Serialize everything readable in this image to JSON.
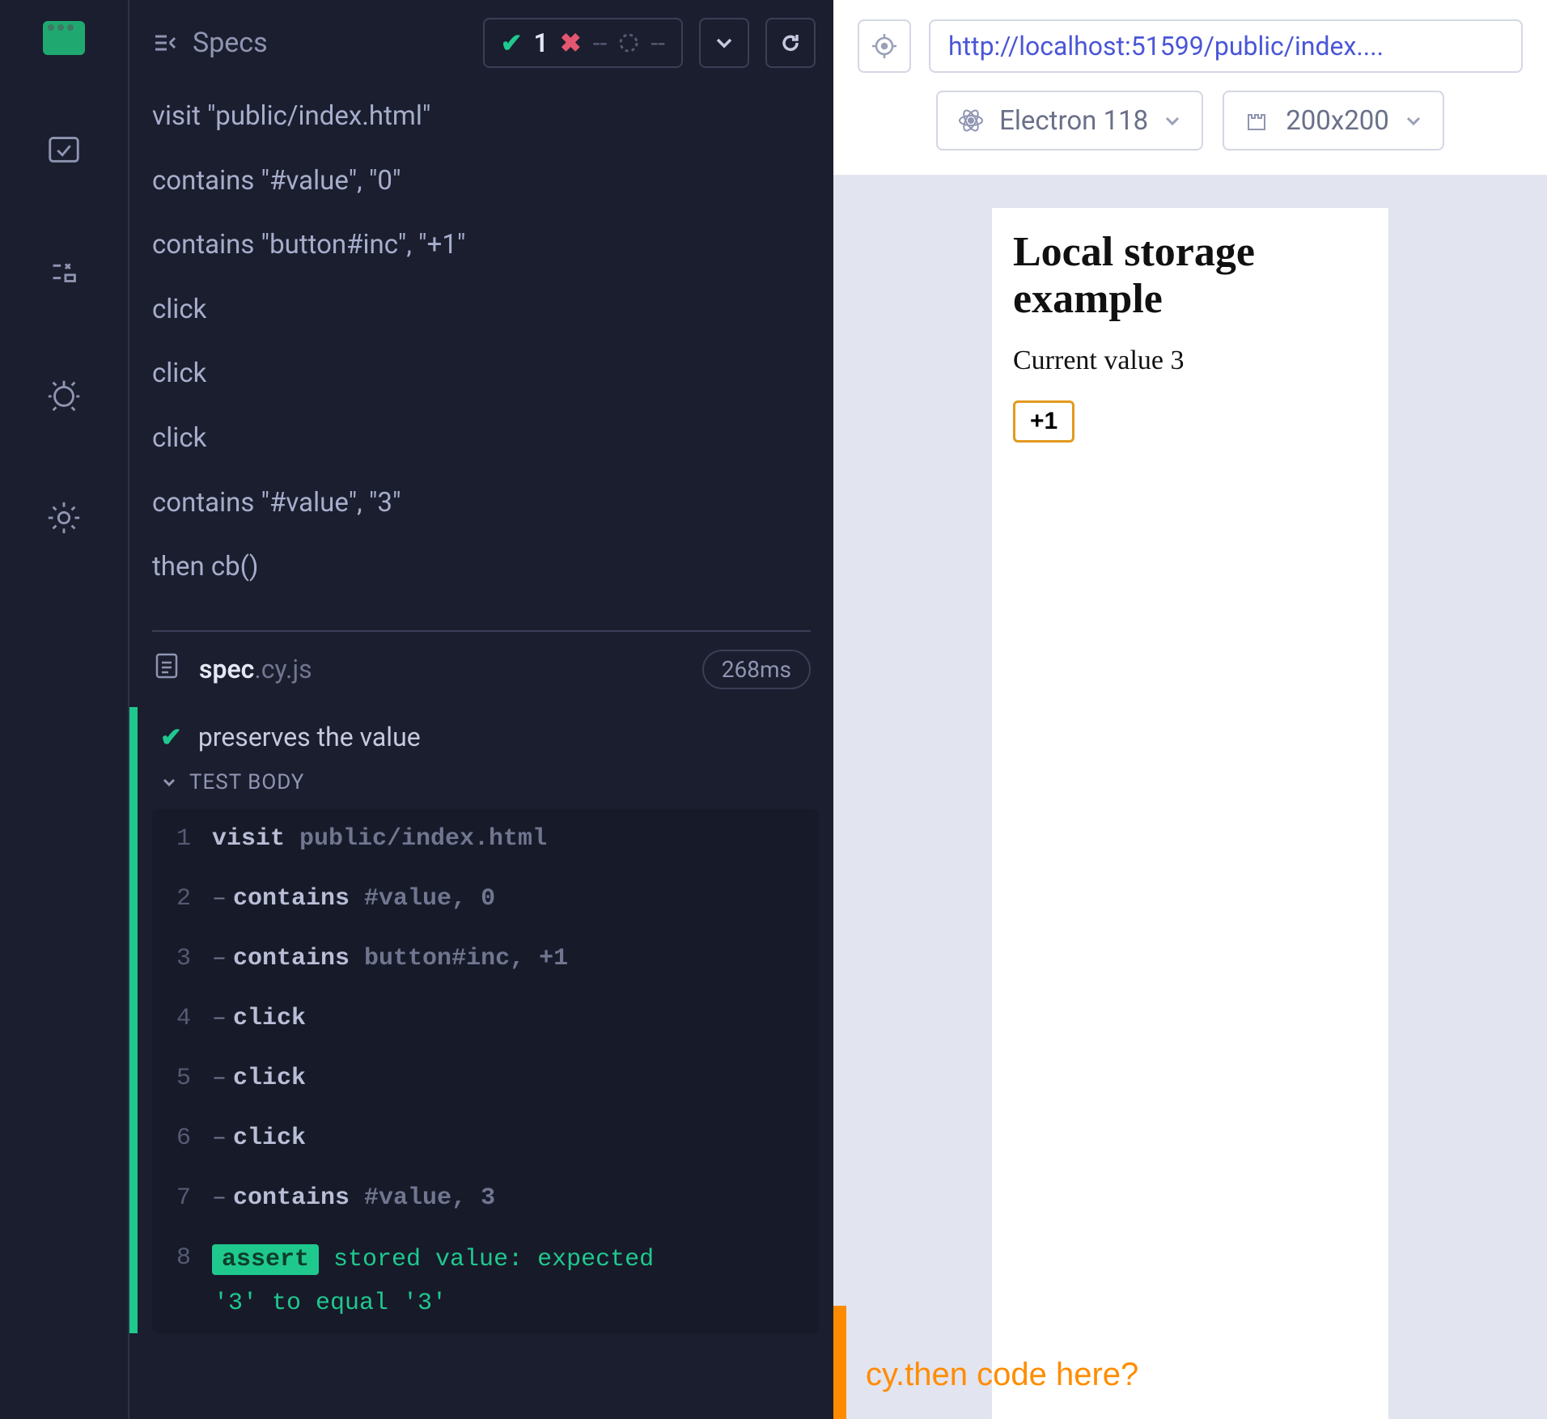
{
  "header": {
    "title": "Specs",
    "passed": "1",
    "failed": "--",
    "pending": "--"
  },
  "summary": {
    "lines": [
      "visit \"public/index.html\"",
      "contains \"#value\", \"0\"",
      "contains \"button#inc\", \"+1\"",
      "click",
      "click",
      "click",
      "contains \"#value\", \"3\"",
      "then cb()"
    ]
  },
  "specFile": {
    "name": "spec",
    "ext": ".cy.js",
    "duration": "268ms"
  },
  "test": {
    "title": "preserves the value",
    "bodyLabel": "TEST BODY"
  },
  "log": [
    {
      "n": "1",
      "dash": false,
      "cmd": "visit",
      "args": "public/index.html"
    },
    {
      "n": "2",
      "dash": true,
      "cmd": "contains",
      "args": "#value, 0"
    },
    {
      "n": "3",
      "dash": true,
      "cmd": "contains",
      "args": "button#inc, +1"
    },
    {
      "n": "4",
      "dash": true,
      "cmd": "click",
      "args": ""
    },
    {
      "n": "5",
      "dash": true,
      "cmd": "click",
      "args": ""
    },
    {
      "n": "6",
      "dash": true,
      "cmd": "click",
      "args": ""
    },
    {
      "n": "7",
      "dash": true,
      "cmd": "contains",
      "args": "#value, 3"
    }
  ],
  "assert": {
    "n": "8",
    "pill": "assert",
    "line1": "stored value: expected",
    "line2": "'3' to equal '3'"
  },
  "aut": {
    "url": "http://localhost:51599/public/index....",
    "browser": "Electron 118",
    "viewport": "200x200"
  },
  "app": {
    "heading": "Local storage example",
    "valueLabel": "Current value 3",
    "buttonLabel": "+1"
  },
  "annotation": "cy.then code here?"
}
